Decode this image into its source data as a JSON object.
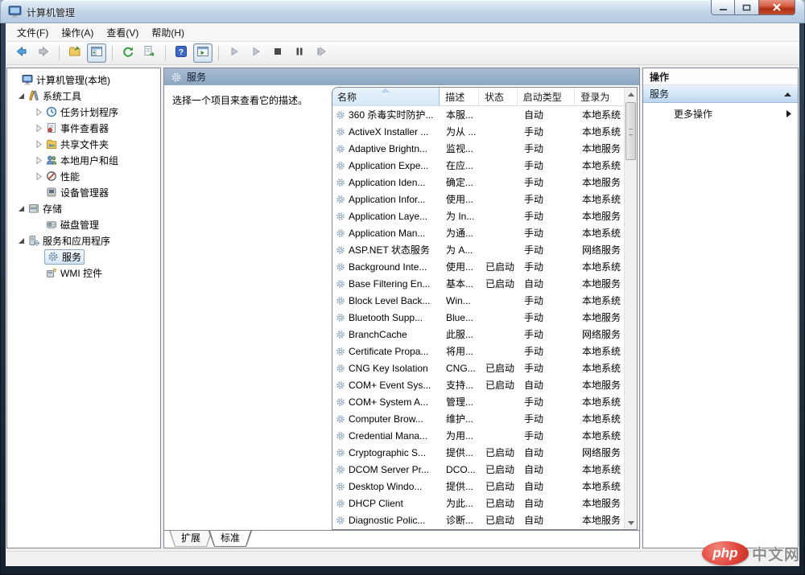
{
  "window": {
    "title": "计算机管理",
    "controls": [
      "minimize",
      "restore",
      "close"
    ]
  },
  "menu": {
    "items": [
      "文件(F)",
      "操作(A)",
      "查看(V)",
      "帮助(H)"
    ]
  },
  "toolbar": {
    "buttons": [
      "back",
      "forward",
      "sep",
      "export-folder",
      "toggle-console-tree",
      "sep",
      "refresh",
      "export-list",
      "sep",
      "help",
      "toggle-action-pane",
      "sep",
      "start-service",
      "resume-service",
      "stop-service",
      "pause-service",
      "restart-service"
    ]
  },
  "tree": {
    "items": [
      {
        "label": "计算机管理(本地)",
        "indent": 0,
        "expander": "none",
        "icon": "computer",
        "selected": false
      },
      {
        "label": "系统工具",
        "indent": 1,
        "expander": "expanded",
        "icon": "tools",
        "selected": false
      },
      {
        "label": "任务计划程序",
        "indent": 2,
        "expander": "collapsed",
        "icon": "task-scheduler",
        "selected": false
      },
      {
        "label": "事件查看器",
        "indent": 2,
        "expander": "collapsed",
        "icon": "event-viewer",
        "selected": false
      },
      {
        "label": "共享文件夹",
        "indent": 2,
        "expander": "collapsed",
        "icon": "shared-folders",
        "selected": false
      },
      {
        "label": "本地用户和组",
        "indent": 2,
        "expander": "collapsed",
        "icon": "local-users",
        "selected": false
      },
      {
        "label": "性能",
        "indent": 2,
        "expander": "collapsed",
        "icon": "performance",
        "selected": false
      },
      {
        "label": "设备管理器",
        "indent": 2,
        "expander": "none",
        "icon": "device-manager",
        "selected": false
      },
      {
        "label": "存储",
        "indent": 1,
        "expander": "expanded",
        "icon": "storage",
        "selected": false
      },
      {
        "label": "磁盘管理",
        "indent": 2,
        "expander": "none",
        "icon": "disk-management",
        "selected": false
      },
      {
        "label": "服务和应用程序",
        "indent": 1,
        "expander": "expanded",
        "icon": "services-apps",
        "selected": false
      },
      {
        "label": "服务",
        "indent": 2,
        "expander": "none",
        "icon": "services",
        "selected": true
      },
      {
        "label": "WMI 控件",
        "indent": 2,
        "expander": "none",
        "icon": "wmi",
        "selected": false
      }
    ]
  },
  "center": {
    "header": "服务",
    "hint": "选择一个项目来查看它的描述。",
    "columns": [
      "名称",
      "描述",
      "状态",
      "启动类型",
      "登录为"
    ],
    "sort": {
      "column": "名称",
      "direction": "asc"
    },
    "rows": [
      {
        "name": "360 杀毒实时防护...",
        "desc": "本服...",
        "status": "",
        "startup": "自动",
        "logon": "本地系统"
      },
      {
        "name": "ActiveX Installer ...",
        "desc": "为从 ...",
        "status": "",
        "startup": "手动",
        "logon": "本地系统"
      },
      {
        "name": "Adaptive Brightn...",
        "desc": "监视...",
        "status": "",
        "startup": "手动",
        "logon": "本地服务"
      },
      {
        "name": "Application Expe...",
        "desc": "在应...",
        "status": "",
        "startup": "手动",
        "logon": "本地系统"
      },
      {
        "name": "Application Iden...",
        "desc": "确定...",
        "status": "",
        "startup": "手动",
        "logon": "本地服务"
      },
      {
        "name": "Application Infor...",
        "desc": "使用...",
        "status": "",
        "startup": "手动",
        "logon": "本地系统"
      },
      {
        "name": "Application Laye...",
        "desc": "为 In...",
        "status": "",
        "startup": "手动",
        "logon": "本地服务"
      },
      {
        "name": "Application Man...",
        "desc": "为通...",
        "status": "",
        "startup": "手动",
        "logon": "本地系统"
      },
      {
        "name": "ASP.NET 状态服务",
        "desc": "为 A...",
        "status": "",
        "startup": "手动",
        "logon": "网络服务"
      },
      {
        "name": "Background Inte...",
        "desc": "使用...",
        "status": "已启动",
        "startup": "手动",
        "logon": "本地系统"
      },
      {
        "name": "Base Filtering En...",
        "desc": "基本...",
        "status": "已启动",
        "startup": "自动",
        "logon": "本地服务"
      },
      {
        "name": "Block Level Back...",
        "desc": "Win...",
        "status": "",
        "startup": "手动",
        "logon": "本地系统"
      },
      {
        "name": "Bluetooth Supp...",
        "desc": "Blue...",
        "status": "",
        "startup": "手动",
        "logon": "本地服务"
      },
      {
        "name": "BranchCache",
        "desc": "此服...",
        "status": "",
        "startup": "手动",
        "logon": "网络服务"
      },
      {
        "name": "Certificate Propa...",
        "desc": "将用...",
        "status": "",
        "startup": "手动",
        "logon": "本地系统"
      },
      {
        "name": "CNG Key Isolation",
        "desc": "CNG...",
        "status": "已启动",
        "startup": "手动",
        "logon": "本地系统"
      },
      {
        "name": "COM+ Event Sys...",
        "desc": "支持...",
        "status": "已启动",
        "startup": "自动",
        "logon": "本地服务"
      },
      {
        "name": "COM+ System A...",
        "desc": "管理...",
        "status": "",
        "startup": "手动",
        "logon": "本地系统"
      },
      {
        "name": "Computer Brow...",
        "desc": "维护...",
        "status": "",
        "startup": "手动",
        "logon": "本地系统"
      },
      {
        "name": "Credential Mana...",
        "desc": "为用...",
        "status": "",
        "startup": "手动",
        "logon": "本地系统"
      },
      {
        "name": "Cryptographic S...",
        "desc": "提供...",
        "status": "已启动",
        "startup": "自动",
        "logon": "网络服务"
      },
      {
        "name": "DCOM Server Pr...",
        "desc": "DCO...",
        "status": "已启动",
        "startup": "自动",
        "logon": "本地系统"
      },
      {
        "name": "Desktop Windo...",
        "desc": "提供...",
        "status": "已启动",
        "startup": "自动",
        "logon": "本地系统"
      },
      {
        "name": "DHCP Client",
        "desc": "为此...",
        "status": "已启动",
        "startup": "自动",
        "logon": "本地服务"
      },
      {
        "name": "Diagnostic Polic...",
        "desc": "诊断...",
        "status": "已启动",
        "startup": "自动",
        "logon": "本地服务"
      }
    ],
    "tabs": [
      {
        "label": "扩展",
        "active": false
      },
      {
        "label": "标准",
        "active": true
      }
    ]
  },
  "actions": {
    "header": "操作",
    "group": "服务",
    "items": [
      "更多操作"
    ]
  },
  "watermark": {
    "badge": "php",
    "text": "中文网"
  },
  "colors": {
    "center_header": "#93aec7",
    "action_group_band": "#bdd8f1",
    "close_button_red": "#b02f14",
    "php_badge_red": "#e2453c",
    "gear_icon": "#8fa9c2"
  }
}
